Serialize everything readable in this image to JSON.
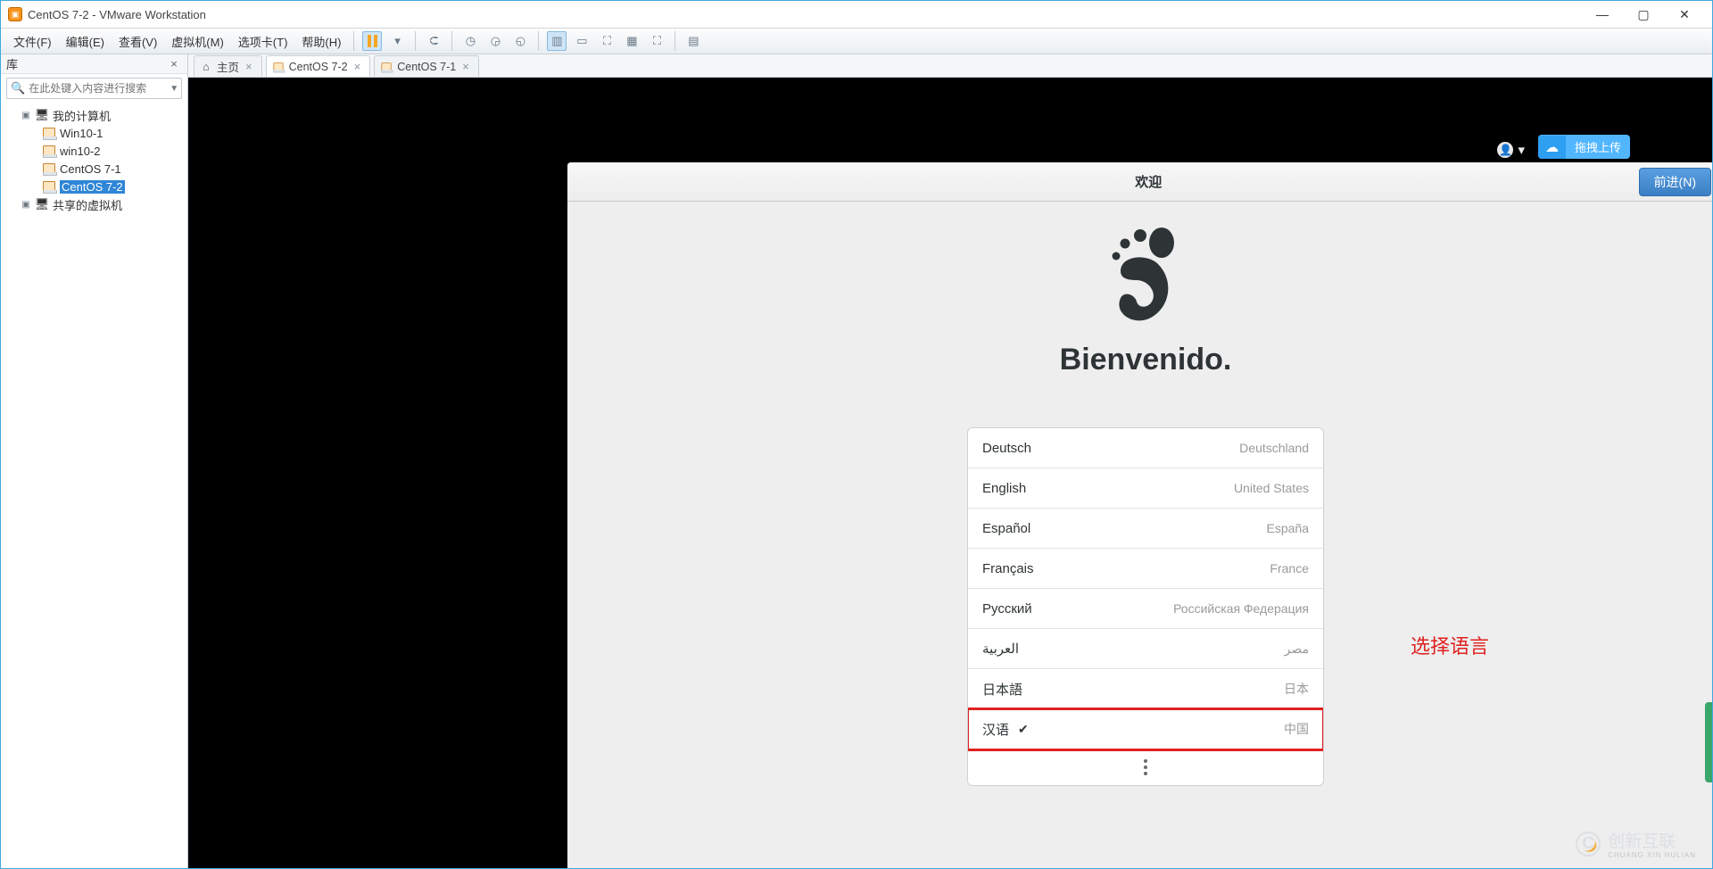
{
  "titlebar": {
    "title": "CentOS 7-2 - VMware Workstation"
  },
  "menu": {
    "file": "文件(F)",
    "edit": "编辑(E)",
    "view": "查看(V)",
    "vm": "虚拟机(M)",
    "tabs": "选项卡(T)",
    "help": "帮助(H)"
  },
  "sidebar": {
    "title": "库",
    "search_placeholder": "在此处键入内容进行搜索",
    "root": "我的计算机",
    "items": [
      "Win10-1",
      "win10-2",
      "CentOS 7-1",
      "CentOS 7-2"
    ],
    "shared": "共享的虚拟机"
  },
  "tabs": {
    "home": "主页",
    "t1": "CentOS 7-2",
    "t2": "CentOS 7-1"
  },
  "upload_badge": "拖拽上传",
  "dialog": {
    "title": "欢迎",
    "next": "前进(N)",
    "heading": "Bienvenido.",
    "langs": [
      {
        "name": "Deutsch",
        "region": "Deutschland",
        "selected": false
      },
      {
        "name": "English",
        "region": "United States",
        "selected": false
      },
      {
        "name": "Español",
        "region": "España",
        "selected": false
      },
      {
        "name": "Français",
        "region": "France",
        "selected": false
      },
      {
        "name": "Русский",
        "region": "Российская Федерация",
        "selected": false
      },
      {
        "name": "العربية",
        "region": "مصر",
        "selected": false
      },
      {
        "name": "日本語",
        "region": "日本",
        "selected": false
      },
      {
        "name": "汉语",
        "region": "中国",
        "selected": true,
        "highlight": true
      }
    ]
  },
  "annotation": "选择语言",
  "watermark": {
    "main": "创新互联",
    "sub": "CHUANG XIN HULIAN"
  }
}
